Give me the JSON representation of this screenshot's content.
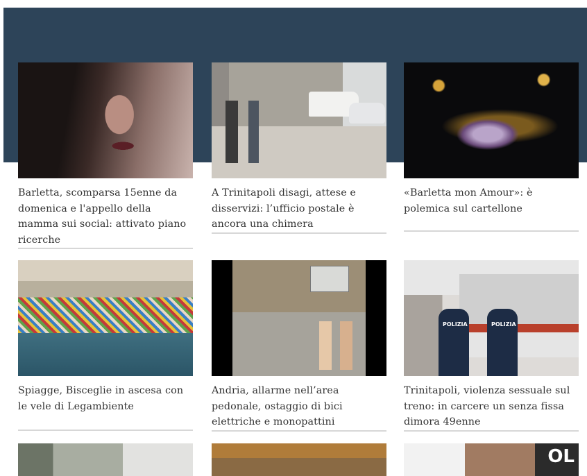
{
  "articles": [
    {
      "title": "Barletta, scomparsa 15enne da domenica e l'appello della mamma sui social: attivato piano ricerche",
      "thumb": "portrait-photo"
    },
    {
      "title": "A Trinitapoli disagi, attese e disservizi: l’ufficio postale è ancora una chimera",
      "thumb": "street-photo"
    },
    {
      "title": "«Barletta mon Amour»: è polemica sul cartellone",
      "thumb": "night-concert-photo"
    },
    {
      "title": "Spiagge, Bisceglie in ascesa con le vele di Legambiente",
      "thumb": "beach-photo"
    },
    {
      "title": "Andria, allarme nell’area pedonale, ostaggio di bici elettriche e monopattini",
      "thumb": "pedestrian-street-photo"
    },
    {
      "title": "Trinitapoli, violenza sessuale sul treno: in carcere un senza fissa dimora 49enne",
      "thumb": "police-train-photo"
    },
    {
      "thumb": "building-photo"
    },
    {
      "thumb": "interior-photo"
    },
    {
      "thumb": "person-photo"
    }
  ],
  "photo_text": {
    "police_badge": "POLIZIA",
    "partial_sign": "OL"
  },
  "colors": {
    "banner": "#2d4459",
    "title_text": "#333333",
    "divider": "#d7d7d7"
  }
}
